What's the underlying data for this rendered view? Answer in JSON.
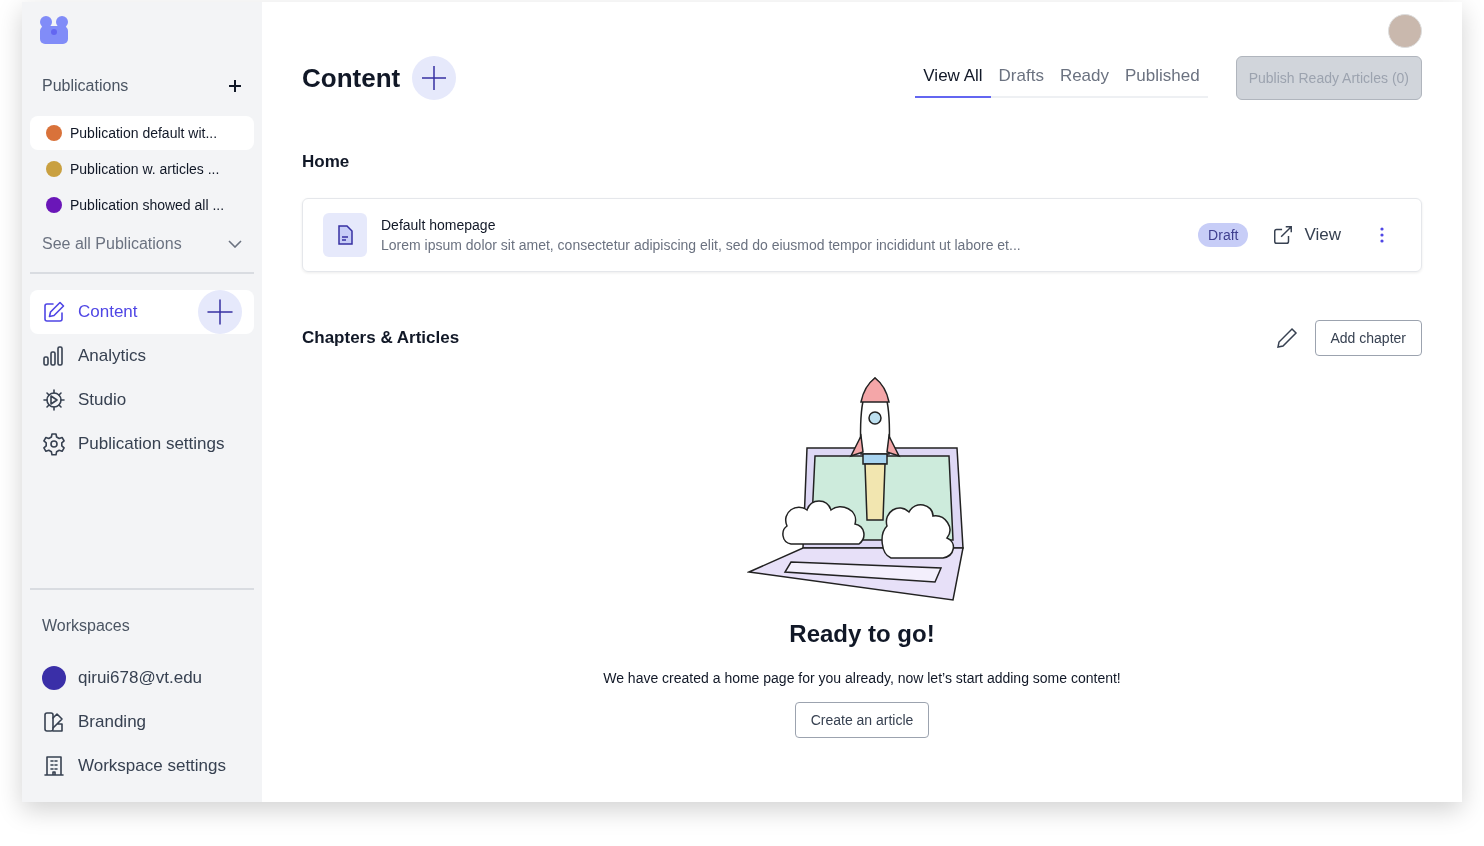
{
  "sidebar": {
    "publications_heading": "Publications",
    "publications": [
      {
        "name": "Publication default wit...",
        "color": "#d9723a",
        "selected": true
      },
      {
        "name": "Publication w. articles ...",
        "color": "#c9a040",
        "selected": false
      },
      {
        "name": "Publication showed all ...",
        "color": "#6a16b8",
        "selected": false
      }
    ],
    "see_all": "See all Publications",
    "nav": [
      {
        "label": "Content",
        "selected": true
      },
      {
        "label": "Analytics",
        "selected": false
      },
      {
        "label": "Studio",
        "selected": false
      },
      {
        "label": "Publication settings",
        "selected": false
      }
    ],
    "workspaces_heading": "Workspaces",
    "workspace": {
      "name": "qirui678@vt.edu",
      "color": "#3a2fa8"
    },
    "workspace_nav": [
      {
        "label": "Branding"
      },
      {
        "label": "Workspace settings"
      }
    ]
  },
  "header": {
    "title": "Content",
    "tabs": [
      {
        "label": "View All",
        "selected": true
      },
      {
        "label": "Drafts",
        "selected": false
      },
      {
        "label": "Ready",
        "selected": false
      },
      {
        "label": "Published",
        "selected": false
      }
    ],
    "publish_button": {
      "label": "Publish Ready Articles (0)",
      "disabled": true
    }
  },
  "home": {
    "heading": "Home",
    "page": {
      "title": "Default homepage",
      "description": "Lorem ipsum dolor sit amet, consectetur adipiscing elit, sed do eiusmod tempor incididunt ut labore et...",
      "status": "Draft",
      "view": "View"
    }
  },
  "chapters": {
    "heading": "Chapters & Articles",
    "add_button": "Add chapter",
    "empty_state": {
      "title": "Ready to go!",
      "text": "We have created a home page for you already, now let’s start adding some content!",
      "button": "Create an article"
    }
  }
}
